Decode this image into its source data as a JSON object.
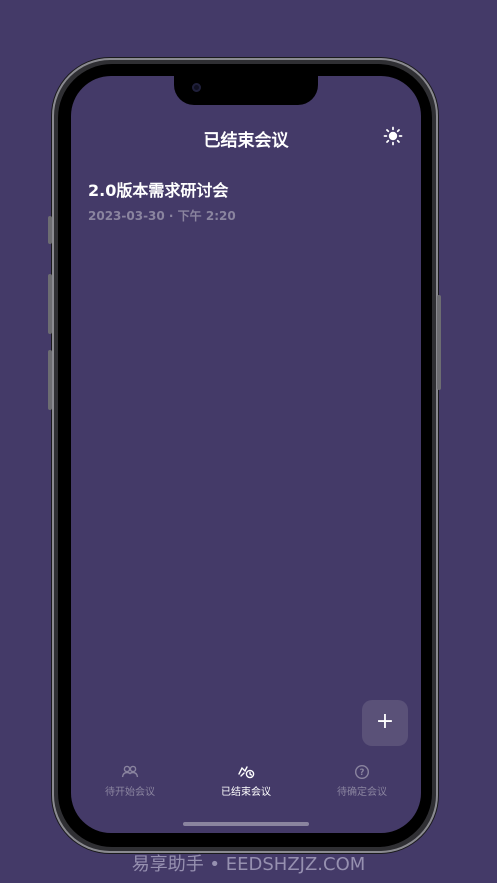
{
  "header": {
    "title": "已结束会议",
    "theme_icon": "sun-icon"
  },
  "meetings": [
    {
      "title": "2.0版本需求研讨会",
      "meta": "2023-03-30 · 下午 2:20"
    }
  ],
  "fab": {
    "label": "+"
  },
  "tabs": [
    {
      "label": "待开始会议",
      "icon": "people-icon",
      "active": false
    },
    {
      "label": "已结束会议",
      "icon": "handshake-clock-icon",
      "active": true
    },
    {
      "label": "待确定会议",
      "icon": "question-circle-icon",
      "active": false
    }
  ],
  "watermark": "易享助手 • EEDSHZJZ.COM",
  "colors": {
    "background": "#443a68",
    "inactive": "#8a849f",
    "active": "#ffffff",
    "fab": "#5a5178"
  }
}
